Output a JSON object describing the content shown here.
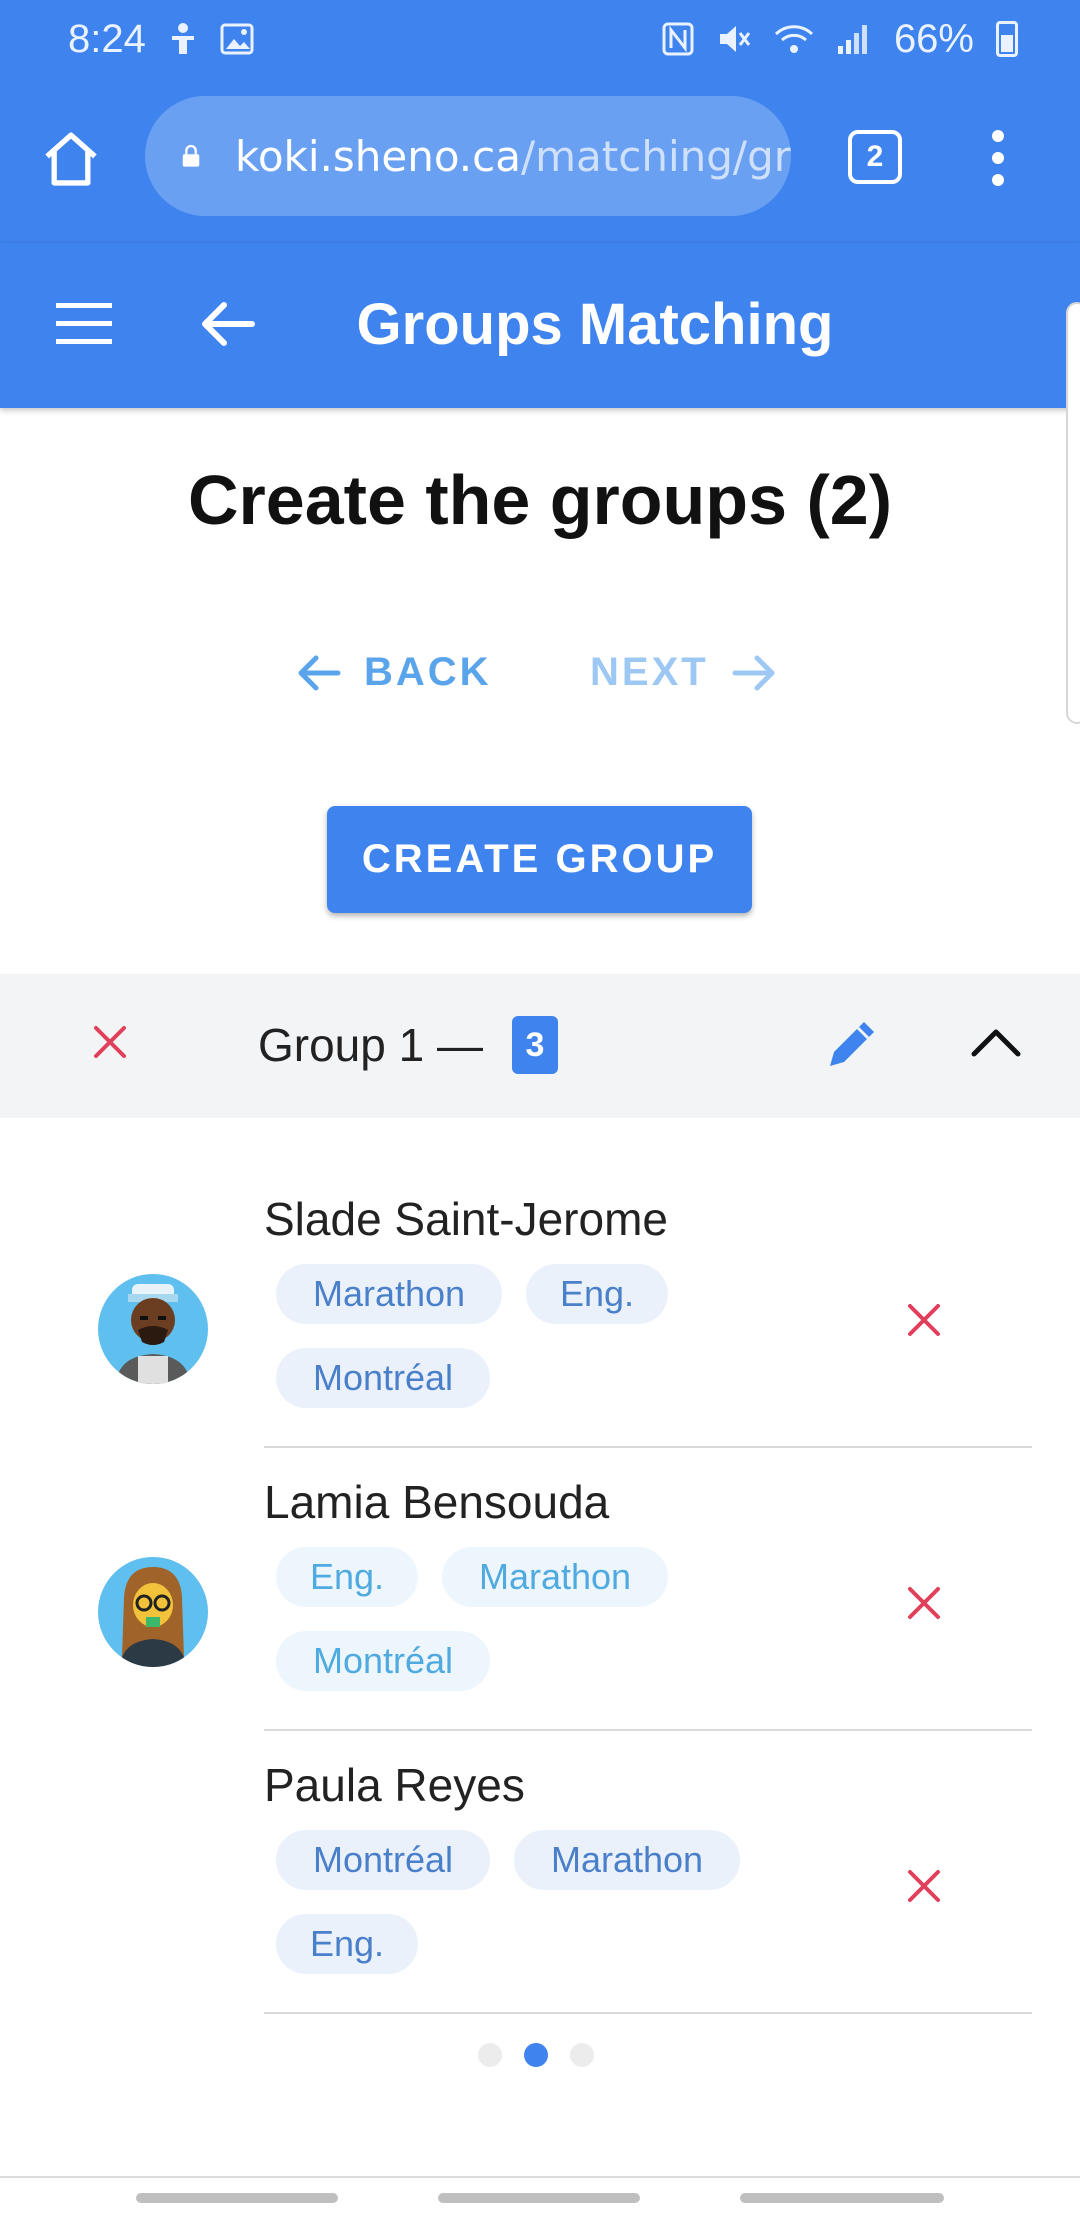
{
  "status_bar": {
    "time": "8:24",
    "battery": "66%",
    "icons": [
      "accessibility-icon",
      "image-icon",
      "nfc-icon",
      "mute-icon",
      "wifi-icon",
      "signal-icon",
      "battery-icon"
    ]
  },
  "browser": {
    "url_host": "koki.sheno.ca",
    "url_path": "/matching/gr",
    "tab_count": "2"
  },
  "app_bar": {
    "title": "Groups Matching"
  },
  "page": {
    "title": "Create the groups (2)",
    "back_label": "BACK",
    "next_label": "NEXT",
    "create_group_label": "CREATE GROUP"
  },
  "group": {
    "label": "Group 1 —",
    "count": "3",
    "members": [
      {
        "name": "Slade Saint-Jerome",
        "chips": [
          "Marathon",
          "Eng.",
          "Montréal"
        ]
      },
      {
        "name": "Lamia Bensouda",
        "chips": [
          "Eng.",
          "Marathon",
          "Montréal"
        ]
      },
      {
        "name": "Paula Reyes",
        "chips": [
          "Montréal",
          "Marathon",
          "Eng."
        ]
      }
    ]
  },
  "pager": {
    "pages": 3,
    "active": 2
  },
  "colors": {
    "primary": "#3f84ee",
    "delete": "#e0405a",
    "chip_bg": "#eaf1fb",
    "chip_text": "#4a7fca"
  }
}
